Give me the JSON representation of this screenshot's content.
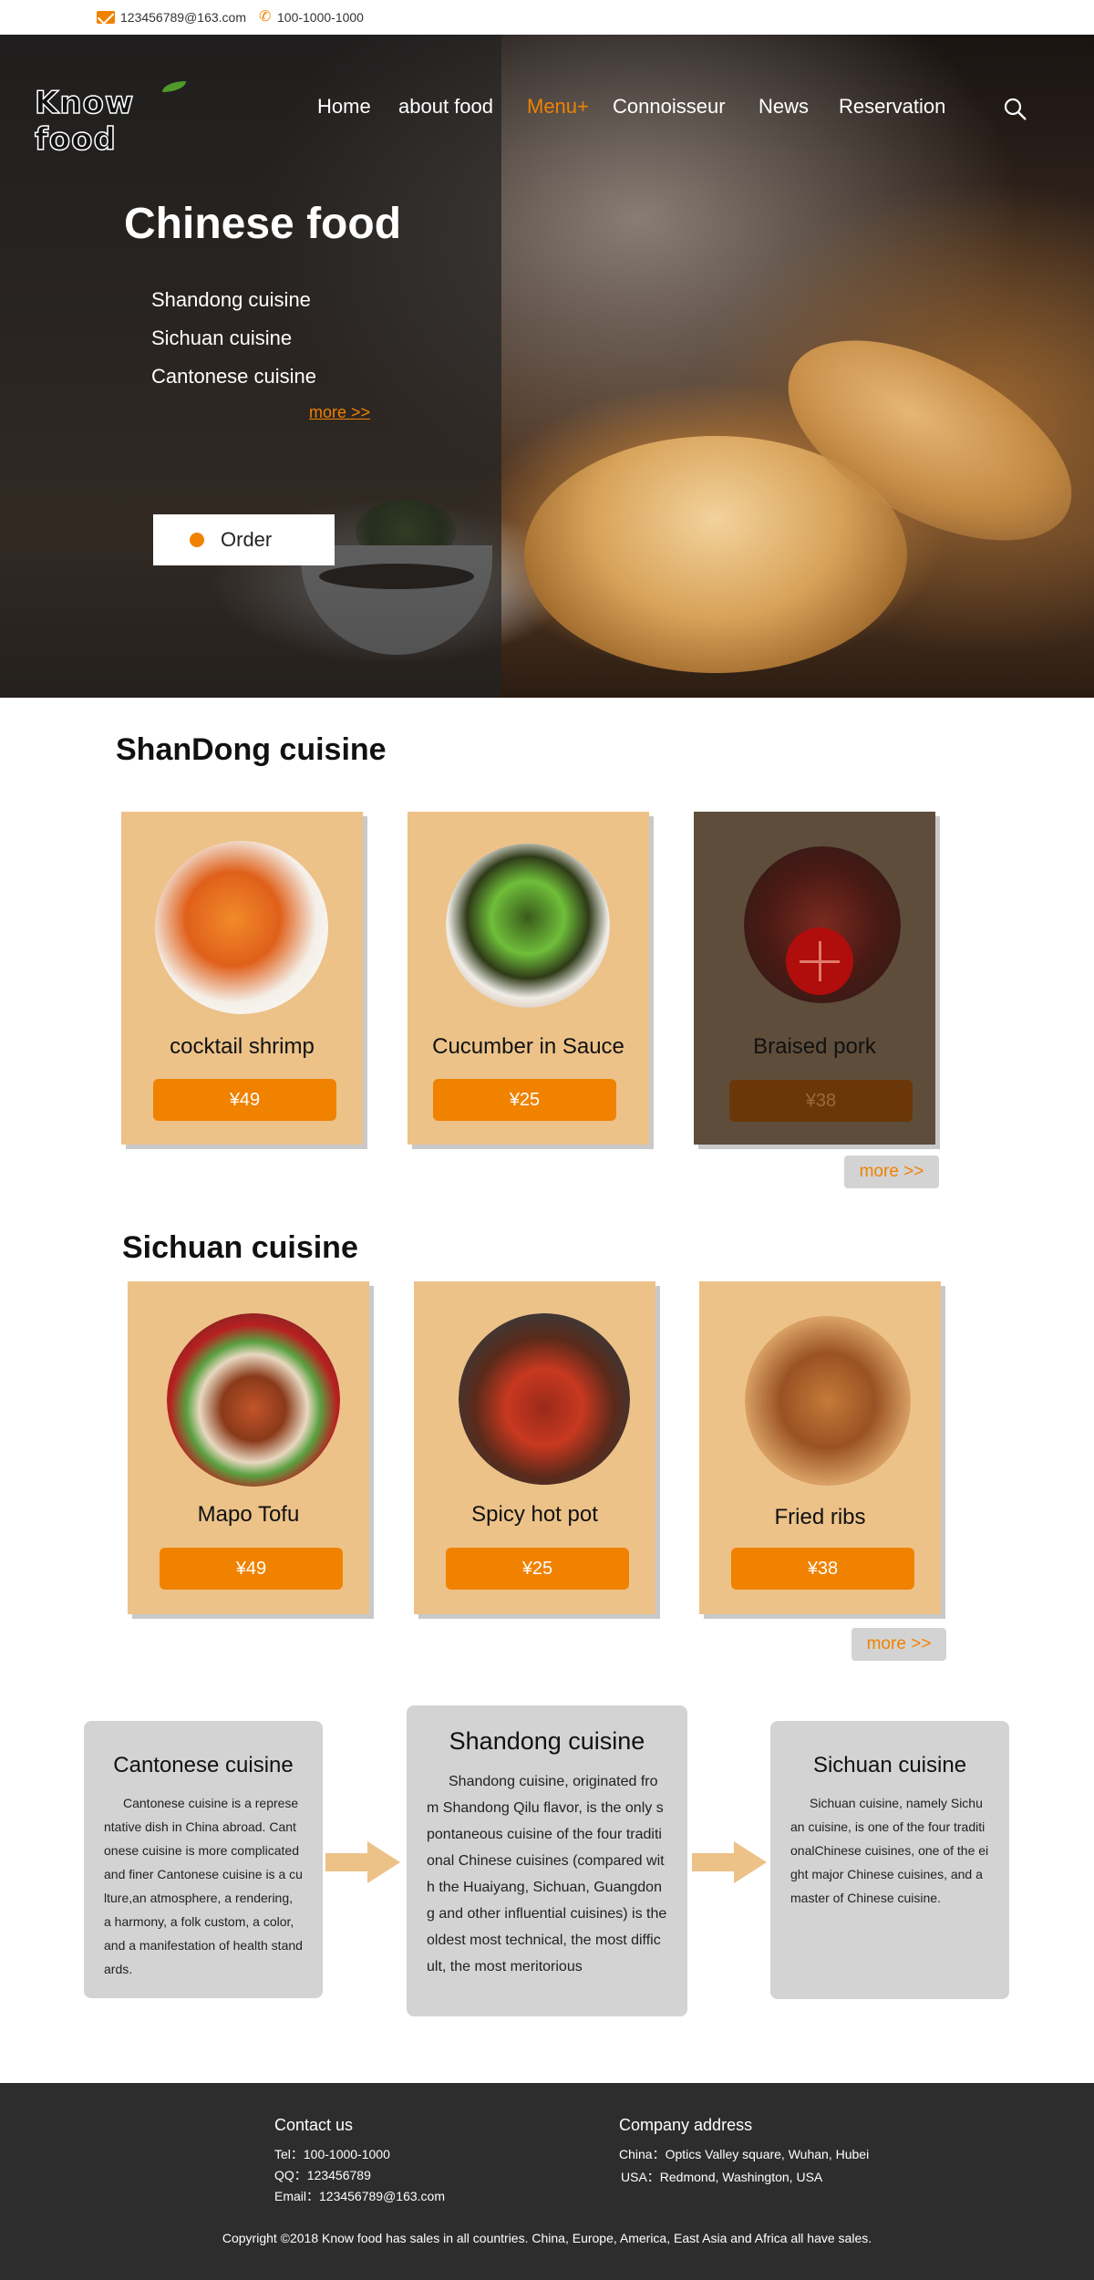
{
  "topbar": {
    "email": "123456789@163.com",
    "phone": "100-1000-1000",
    "email_icon": "mail-icon",
    "phone_icon": "phone-icon"
  },
  "brand": {
    "logo_text": "Know food"
  },
  "nav": {
    "items": [
      {
        "label": "Home",
        "active": false
      },
      {
        "label": "about food",
        "active": false
      },
      {
        "label": "Menu+",
        "active": true
      },
      {
        "label": "Connoisseur",
        "active": false
      },
      {
        "label": "News",
        "active": false
      },
      {
        "label": "Reservation",
        "active": false
      }
    ],
    "search_icon": "search-icon"
  },
  "hero": {
    "title": "Chinese food",
    "list": [
      "Shandong cuisine",
      "Sichuan cuisine",
      "Cantonese cuisine"
    ],
    "more": "more >>",
    "order": "Order"
  },
  "shandong": {
    "title": "ShanDong cuisine",
    "items": [
      {
        "name": "cocktail shrimp",
        "price": "¥49"
      },
      {
        "name": "Cucumber in Sauce",
        "price": "¥25"
      },
      {
        "name": "Braised pork",
        "price": "¥38"
      }
    ],
    "more": "more >>"
  },
  "sichuan": {
    "title": "Sichuan cuisine",
    "items": [
      {
        "name": "Mapo Tofu",
        "price": "¥49"
      },
      {
        "name": "Spicy hot pot",
        "price": "¥25"
      },
      {
        "name": "Fried ribs",
        "price": "¥38"
      }
    ],
    "more": "more >>"
  },
  "intro": {
    "cantonese": {
      "title": "Cantonese cuisine",
      "text": "Cantonese cuisine is a representative dish in China abroad. Cantonese cuisine is more complicated and finer Cantonese cuisine is a culture,an atmosphere, a rendering, a harmony, a folk custom, a color, and a manifestation of health standards."
    },
    "shandong": {
      "title": "Shandong cuisine",
      "text": "Shandong cuisine, originated from Shandong Qilu flavor, is the only spontaneous cuisine of the four traditional Chinese cuisines (compared with the Huaiyang, Sichuan, Guangdong and other influential cuisines) is the oldest most technical, the most difficult, the most meritorious"
    },
    "sichuan": {
      "title": "Sichuan cuisine",
      "text": "Sichuan cuisine, namely Sichuan cuisine, is one of the four traditionalChinese cuisines, one of the eight major Chinese cuisines, and a master of Chinese cuisine."
    }
  },
  "footer": {
    "contact_title": "Contact us",
    "tel": "Tel：100-1000-1000",
    "qq": "QQ：123456789",
    "email": "Email：123456789@163.com",
    "address_title": "Company address",
    "china": "China：Optics Valley square, Wuhan, Hubei",
    "usa": "USA：Redmond, Washington, USA",
    "copyright": "Copyright ©2018 Know food has sales in all countries. China, Europe, America, East Asia and Africa all have sales."
  },
  "colors": {
    "accent": "#f08200",
    "card": "#ecc289",
    "footer": "#2d2d2d",
    "box": "#d3d3d3"
  }
}
